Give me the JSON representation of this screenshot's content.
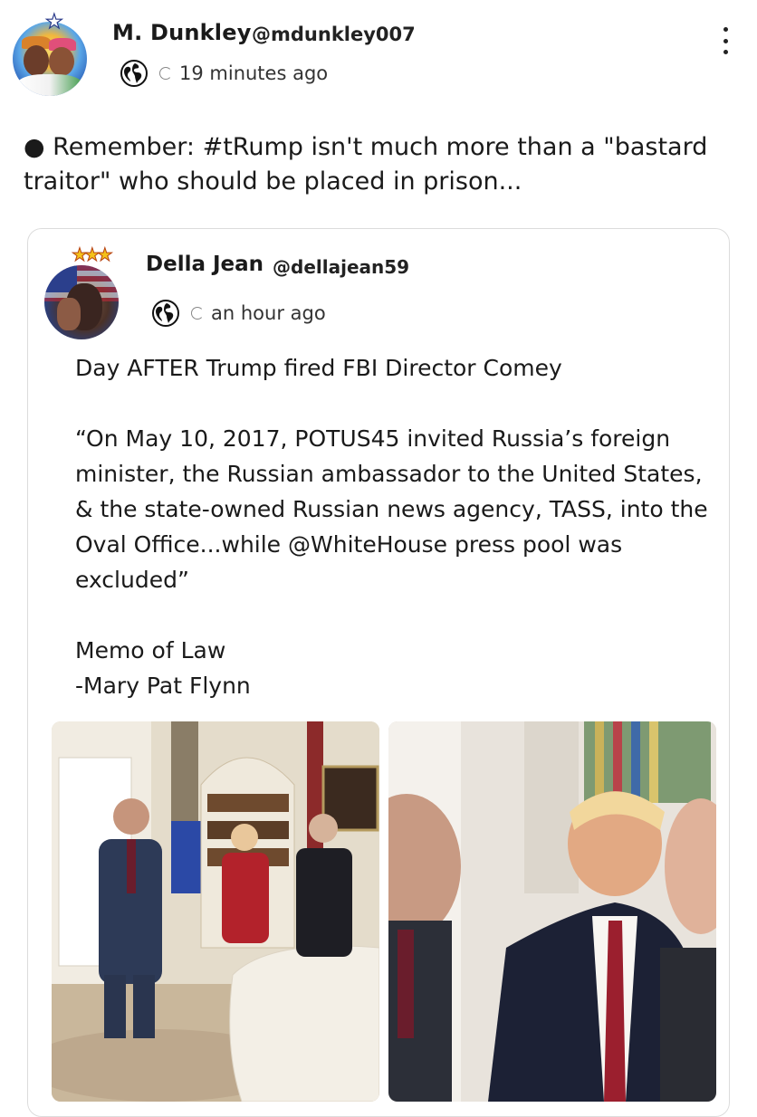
{
  "post": {
    "author_name": "M. Dunkley",
    "author_handle": "@mdunkley007",
    "time": "19 minutes ago",
    "visibility_icon": "globe-icon",
    "text": "● Remember: #tRump isn't much more than a \"bastard traitor\" who should be placed in prison..."
  },
  "quote": {
    "author_name": "Della Jean",
    "author_handle": "@dellajean59",
    "time": "an hour ago",
    "visibility_icon": "globe-icon",
    "line1": "Day AFTER Trump fired FBI Director Comey",
    "paragraph": "“On May 10, 2017, POTUS45 invited Russia’s foreign minister, the Russian ambassador to the United States, & the state-owned Russian news agency, TASS, into the Oval Office...while @WhiteHouse press pool was excluded”",
    "memo_line": "Memo of Law",
    "signature_line": "-Mary Pat Flynn"
  },
  "icons": {
    "more": "kebab-menu-icon",
    "globe": "globe-icon"
  }
}
